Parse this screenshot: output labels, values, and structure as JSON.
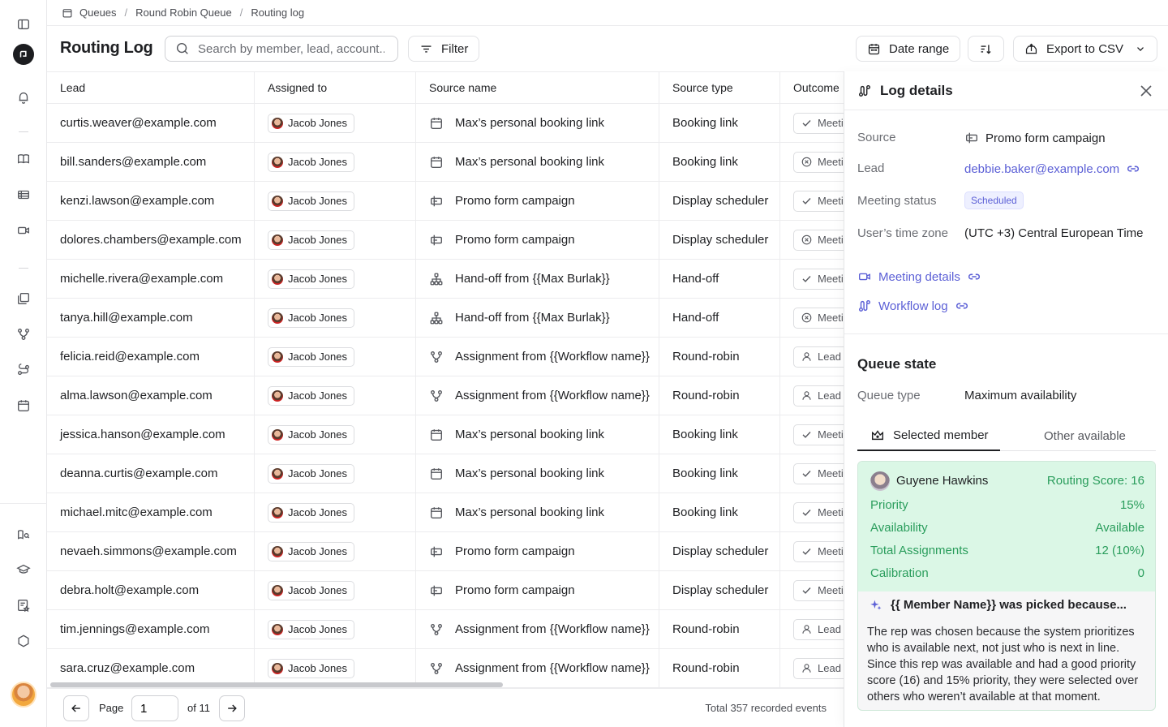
{
  "breadcrumb": [
    "Queues",
    "Round Robin Queue",
    "Routing log"
  ],
  "header": {
    "title": "Routing Log",
    "search_placeholder": "Search by member, lead, account...",
    "filter_label": "Filter",
    "date_range_label": "Date range",
    "export_label": "Export to CSV"
  },
  "table": {
    "columns": [
      "Lead",
      "Assigned to",
      "Source name",
      "Source type",
      "Outcome"
    ],
    "rows": [
      {
        "lead": "curtis.weaver@example.com",
        "assigned": "Jacob Jones",
        "source_icon": "calendar-icon",
        "source": "Max’s personal booking link",
        "type": "Booking link",
        "outcome_icon": "check-icon",
        "outcome": "Meeting"
      },
      {
        "lead": "bill.sanders@example.com",
        "assigned": "Jacob Jones",
        "source_icon": "calendar-icon",
        "source": "Max’s personal booking link",
        "type": "Booking link",
        "outcome_icon": "x-circle-icon",
        "outcome": "Meeting"
      },
      {
        "lead": "kenzi.lawson@example.com",
        "assigned": "Jacob Jones",
        "source_icon": "form-icon",
        "source": "Promo form campaign",
        "type": "Display scheduler",
        "outcome_icon": "check-icon",
        "outcome": "Meeting"
      },
      {
        "lead": "dolores.chambers@example.com",
        "assigned": "Jacob Jones",
        "source_icon": "form-icon",
        "source": "Promo form campaign",
        "type": "Display scheduler",
        "outcome_icon": "x-circle-icon",
        "outcome": "Meeting"
      },
      {
        "lead": "michelle.rivera@example.com",
        "assigned": "Jacob Jones",
        "source_icon": "hierarchy-icon",
        "source": "Hand-off from {{Max Burlak}}",
        "type": "Hand-off",
        "outcome_icon": "check-icon",
        "outcome": "Meeting"
      },
      {
        "lead": "tanya.hill@example.com",
        "assigned": "Jacob Jones",
        "source_icon": "hierarchy-icon",
        "source": "Hand-off from {{Max Burlak}}",
        "type": "Hand-off",
        "outcome_icon": "x-circle-icon",
        "outcome": "Meeting"
      },
      {
        "lead": "felicia.reid@example.com",
        "assigned": "Jacob Jones",
        "source_icon": "workflow-icon",
        "source": "Assignment from {{Workflow name}}",
        "type": "Round-robin",
        "outcome_icon": "user-icon",
        "outcome": "Lead a"
      },
      {
        "lead": "alma.lawson@example.com",
        "assigned": "Jacob Jones",
        "source_icon": "workflow-icon",
        "source": "Assignment from {{Workflow name}}",
        "type": "Round-robin",
        "outcome_icon": "user-icon",
        "outcome": "Lead r"
      },
      {
        "lead": "jessica.hanson@example.com",
        "assigned": "Jacob Jones",
        "source_icon": "calendar-icon",
        "source": "Max’s personal booking link",
        "type": "Booking link",
        "outcome_icon": "check-icon",
        "outcome": "Meeting"
      },
      {
        "lead": "deanna.curtis@example.com",
        "assigned": "Jacob Jones",
        "source_icon": "calendar-icon",
        "source": "Max’s personal booking link",
        "type": "Booking link",
        "outcome_icon": "check-icon",
        "outcome": "Meeting"
      },
      {
        "lead": "michael.mitc@example.com",
        "assigned": "Jacob Jones",
        "source_icon": "calendar-icon",
        "source": "Max’s personal booking link",
        "type": "Booking link",
        "outcome_icon": "check-icon",
        "outcome": "Meeting"
      },
      {
        "lead": "nevaeh.simmons@example.com",
        "assigned": "Jacob Jones",
        "source_icon": "form-icon",
        "source": "Promo form campaign",
        "type": "Display scheduler",
        "outcome_icon": "check-icon",
        "outcome": "Meeting"
      },
      {
        "lead": "debra.holt@example.com",
        "assigned": "Jacob Jones",
        "source_icon": "form-icon",
        "source": "Promo form campaign",
        "type": "Display scheduler",
        "outcome_icon": "check-icon",
        "outcome": "Meeting"
      },
      {
        "lead": "tim.jennings@example.com",
        "assigned": "Jacob Jones",
        "source_icon": "workflow-icon",
        "source": "Assignment from {{Workflow name}}",
        "type": "Round-robin",
        "outcome_icon": "user-icon",
        "outcome": "Lead a"
      },
      {
        "lead": "sara.cruz@example.com",
        "assigned": "Jacob Jones",
        "source_icon": "workflow-icon",
        "source": "Assignment from {{Workflow name}}",
        "type": "Round-robin",
        "outcome_icon": "user-icon",
        "outcome": "Lead a"
      }
    ]
  },
  "pagination": {
    "page_label": "Page",
    "current_page": "1",
    "of_label": "of 11",
    "total_label": "Total 357 recorded events"
  },
  "panel": {
    "title": "Log details",
    "source_label": "Source",
    "source_value": "Promo form campaign",
    "lead_label": "Lead",
    "lead_value": "debbie.baker@example.com",
    "status_label": "Meeting status",
    "status_value": "Scheduled",
    "tz_label": "User’s time zone",
    "tz_value": "(UTC +3) Central European Time",
    "meeting_details_link": "Meeting details",
    "workflow_log_link": "Workflow log",
    "queue_state_title": "Queue state",
    "queue_type_label": "Queue type",
    "queue_type_value": "Maximum availability",
    "tab_selected": "Selected member",
    "tab_other": "Other available",
    "member": {
      "name": "Guyene Hawkins",
      "score": "Routing Score: 16",
      "stats": [
        {
          "label": "Priority",
          "value": "15%"
        },
        {
          "label": "Availability",
          "value": "Available"
        },
        {
          "label": "Total Assignments",
          "value": "12 (10%)"
        },
        {
          "label": "Calibration",
          "value": "0"
        }
      ]
    },
    "why_title": "{{ Member Name}} was picked because...",
    "why_text": "The rep was chosen because the system prioritizes who is available next, not just who is next in line. Since this rep was available and had a good priority score (16) and 15% priority, they were selected over others who weren’t available at that moment."
  },
  "colors": {
    "accent": "#5b5fd6",
    "success": "#2a9d5c",
    "success_bg": "#dbf7e6"
  }
}
